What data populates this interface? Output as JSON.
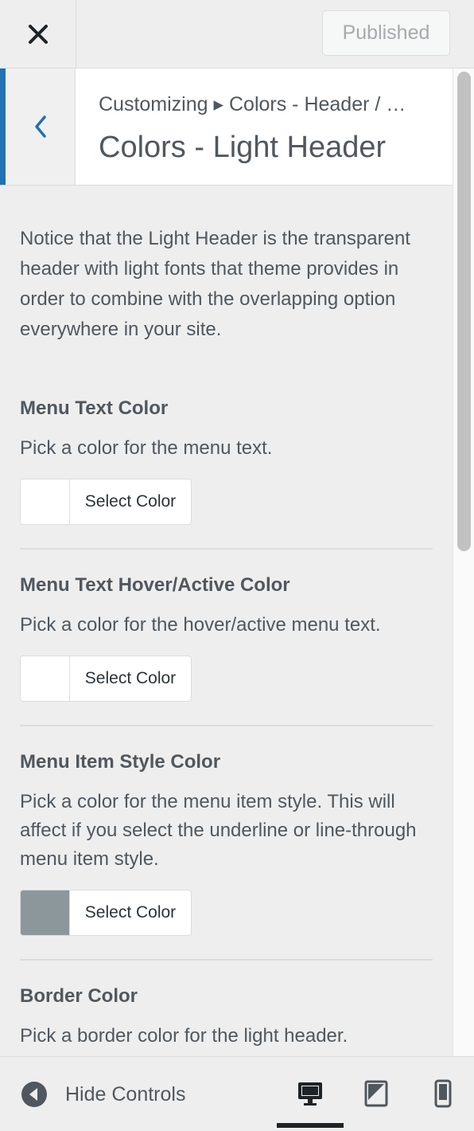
{
  "topbar": {
    "close_icon": "close-icon",
    "publish_label": "Published"
  },
  "section": {
    "back_icon": "chevron-left-icon",
    "breadcrumb": "Customizing ▸ Colors - Header / …",
    "title": "Colors - Light Header"
  },
  "content": {
    "description": "Notice that the Light Header is the transparent header with light fonts that theme provides in order to combine with the overlapping option everywhere in your site.",
    "controls": [
      {
        "title": "Menu Text Color",
        "description": "Pick a color for the menu text.",
        "button_label": "Select Color",
        "swatch": "#ffffff"
      },
      {
        "title": "Menu Text Hover/Active Color",
        "description": "Pick a color for the hover/active menu text.",
        "button_label": "Select Color",
        "swatch": "#ffffff"
      },
      {
        "title": "Menu Item Style Color",
        "description": "Pick a color for the menu item style. This will affect if you select the underline or line-through menu item style.",
        "button_label": "Select Color",
        "swatch": "#8c979b"
      },
      {
        "title": "Border Color",
        "description": "Pick a border color for the light header."
      }
    ]
  },
  "footer": {
    "hide_controls_label": "Hide Controls",
    "devices": [
      "desktop-icon",
      "tablet-icon",
      "mobile-icon"
    ],
    "active_device": "desktop"
  },
  "colors": {
    "accent": "#2271b1",
    "text": "#50575e",
    "panel_bg": "#eeeeee"
  }
}
